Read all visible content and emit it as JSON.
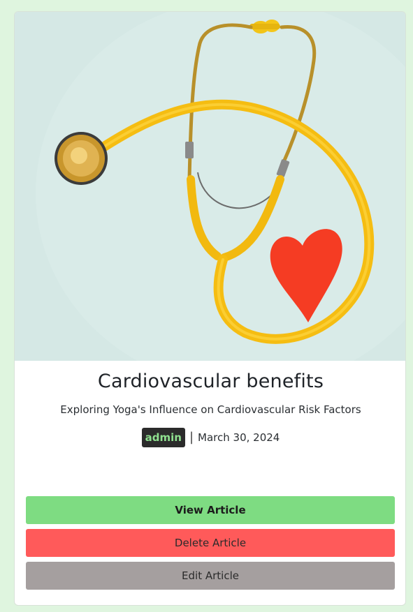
{
  "article": {
    "title": "Cardiovascular benefits",
    "subtitle": "Exploring Yoga's Influence on Cardiovascular Risk Factors",
    "author": "admin",
    "separator": "|",
    "date": "March 30, 2024"
  },
  "actions": {
    "view_label": "View Article",
    "delete_label": "Delete Article",
    "edit_label": "Edit Article"
  },
  "colors": {
    "page_background": "#dff5df",
    "view_button": "#7edc82",
    "delete_button": "#ff5a5a",
    "edit_button": "#a59f9f",
    "author_badge": "#2b2b2b",
    "author_text": "#8fe08f"
  },
  "image": {
    "icon": "stethoscope-heart-image"
  }
}
